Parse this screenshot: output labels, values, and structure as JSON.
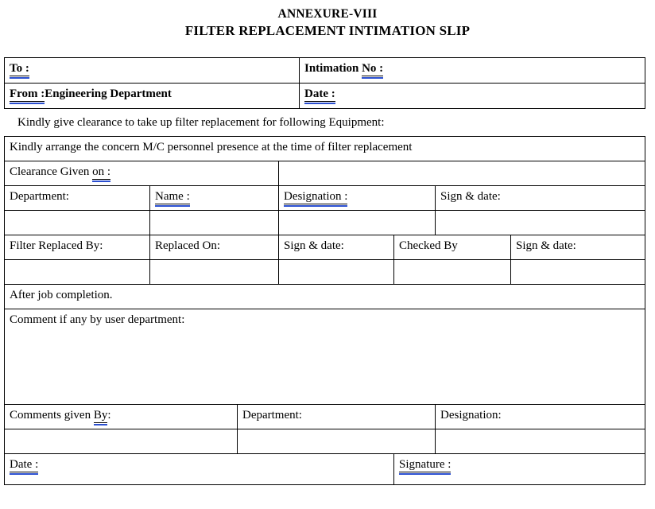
{
  "document": {
    "title_line_1": "ANNEXURE-VIII",
    "title_line_2": "FILTER REPLACEMENT INTIMATION SLIP",
    "intro_text": "Kindly give clearance to take up filter replacement for following Equipment:",
    "accent_underline_color": "#2b4fd0",
    "border_color": "#000000"
  },
  "header_table": {
    "to_label": "To :",
    "intimation_label": "Intimation ",
    "intimation_label_underlined": "No :",
    "from_label": "From :",
    "from_value": "Engineering Department",
    "date_label": "Date :"
  },
  "main_table": {
    "notice_row": "Kindly arrange the concern M/C personnel presence at the time of filter replacement",
    "clearance_row": {
      "label_plain": "Clearance Given ",
      "label_underlined": "on :",
      "value": ""
    },
    "personnel_header": {
      "department": "Department:",
      "name": "Name :",
      "designation": "Designation :",
      "sign_date": "Sign & date:"
    },
    "personnel_values": {
      "department": "",
      "name": "",
      "designation": "",
      "sign_date": ""
    },
    "replacement_header": {
      "filter_replaced_by": "Filter Replaced By:",
      "replaced_on": "Replaced On:",
      "sign_date_1": "Sign & date:",
      "checked_by": "Checked By",
      "sign_date_2": "Sign & date:"
    },
    "replacement_values": {
      "filter_replaced_by": "",
      "replaced_on": "",
      "sign_date_1": "",
      "checked_by": "",
      "sign_date_2": ""
    },
    "after_job_row": "After job completion.",
    "comment_row": "Comment if any by user department:",
    "comment_value": "",
    "comments_given_header": {
      "comments_given_by_plain": "Comments given ",
      "comments_given_by_underlined": "By",
      "comments_given_by_suffix": ":",
      "department": "Department:",
      "designation": "Designation:"
    },
    "comments_given_values": {
      "comments_given_by": "",
      "department": "",
      "designation": ""
    },
    "footer_row": {
      "date_label": "Date :",
      "signature_label": "Signature :",
      "date_value": "",
      "signature_value": ""
    }
  }
}
